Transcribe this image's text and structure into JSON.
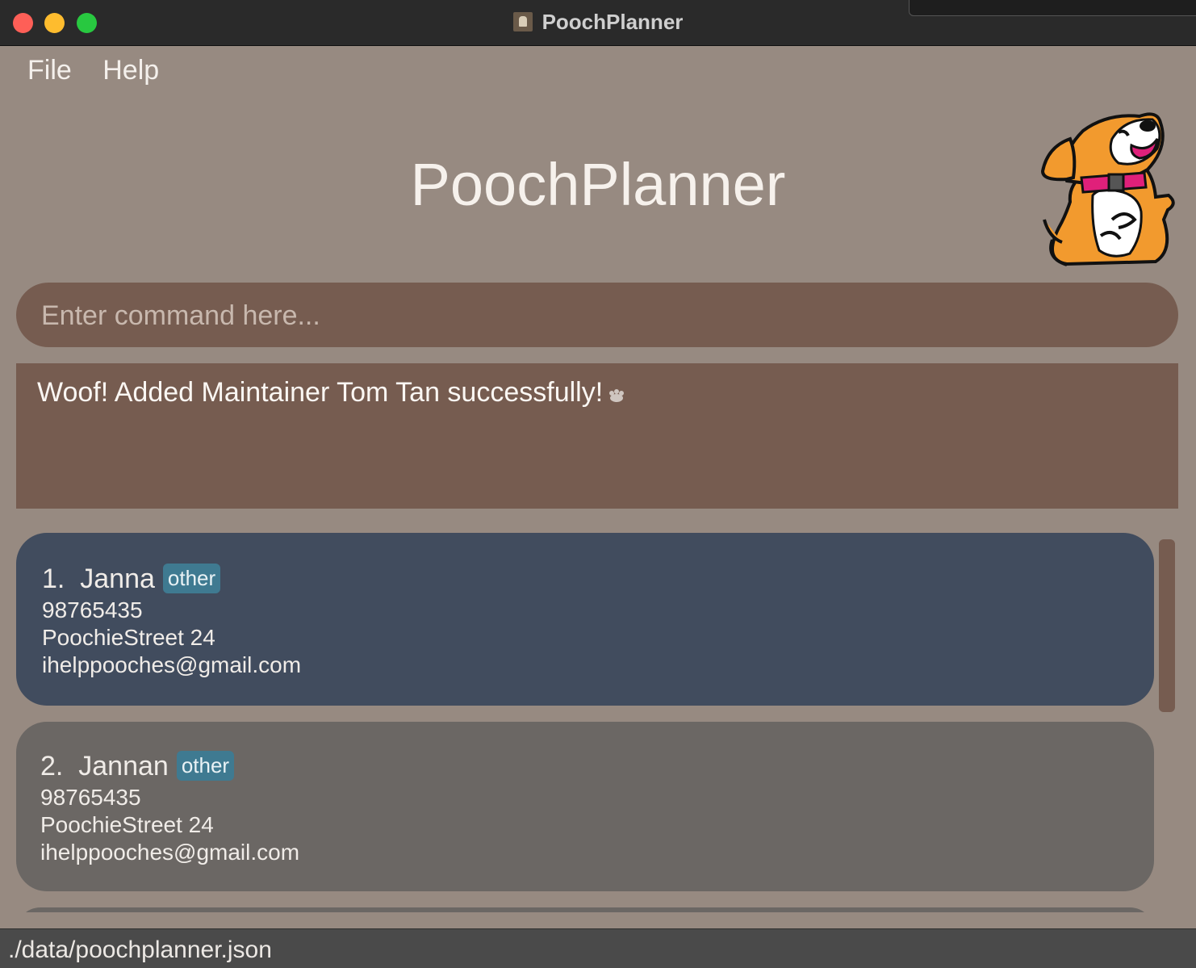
{
  "window": {
    "title": "PoochPlanner"
  },
  "menu": {
    "items": [
      "File",
      "Help"
    ]
  },
  "header": {
    "title": "PoochPlanner"
  },
  "command": {
    "placeholder": "Enter command here...",
    "value": ""
  },
  "result": {
    "message": "Woof! Added Maintainer Tom Tan successfully!"
  },
  "contacts": [
    {
      "index": "1.",
      "name": "Janna",
      "tag": "other",
      "phone": "98765435",
      "address": "PoochieStreet 24",
      "email": "ihelppooches@gmail.com"
    },
    {
      "index": "2.",
      "name": "Jannan",
      "tag": "other",
      "phone": "98765435",
      "address": "PoochieStreet 24",
      "email": "ihelppooches@gmail.com"
    }
  ],
  "status": {
    "file_path": "./data/poochplanner.json"
  },
  "colors": {
    "background": "#978a81",
    "panel": "#765c50",
    "selected_card": "#414c5e",
    "card": "#6b6764",
    "tag": "#3f7a91"
  }
}
